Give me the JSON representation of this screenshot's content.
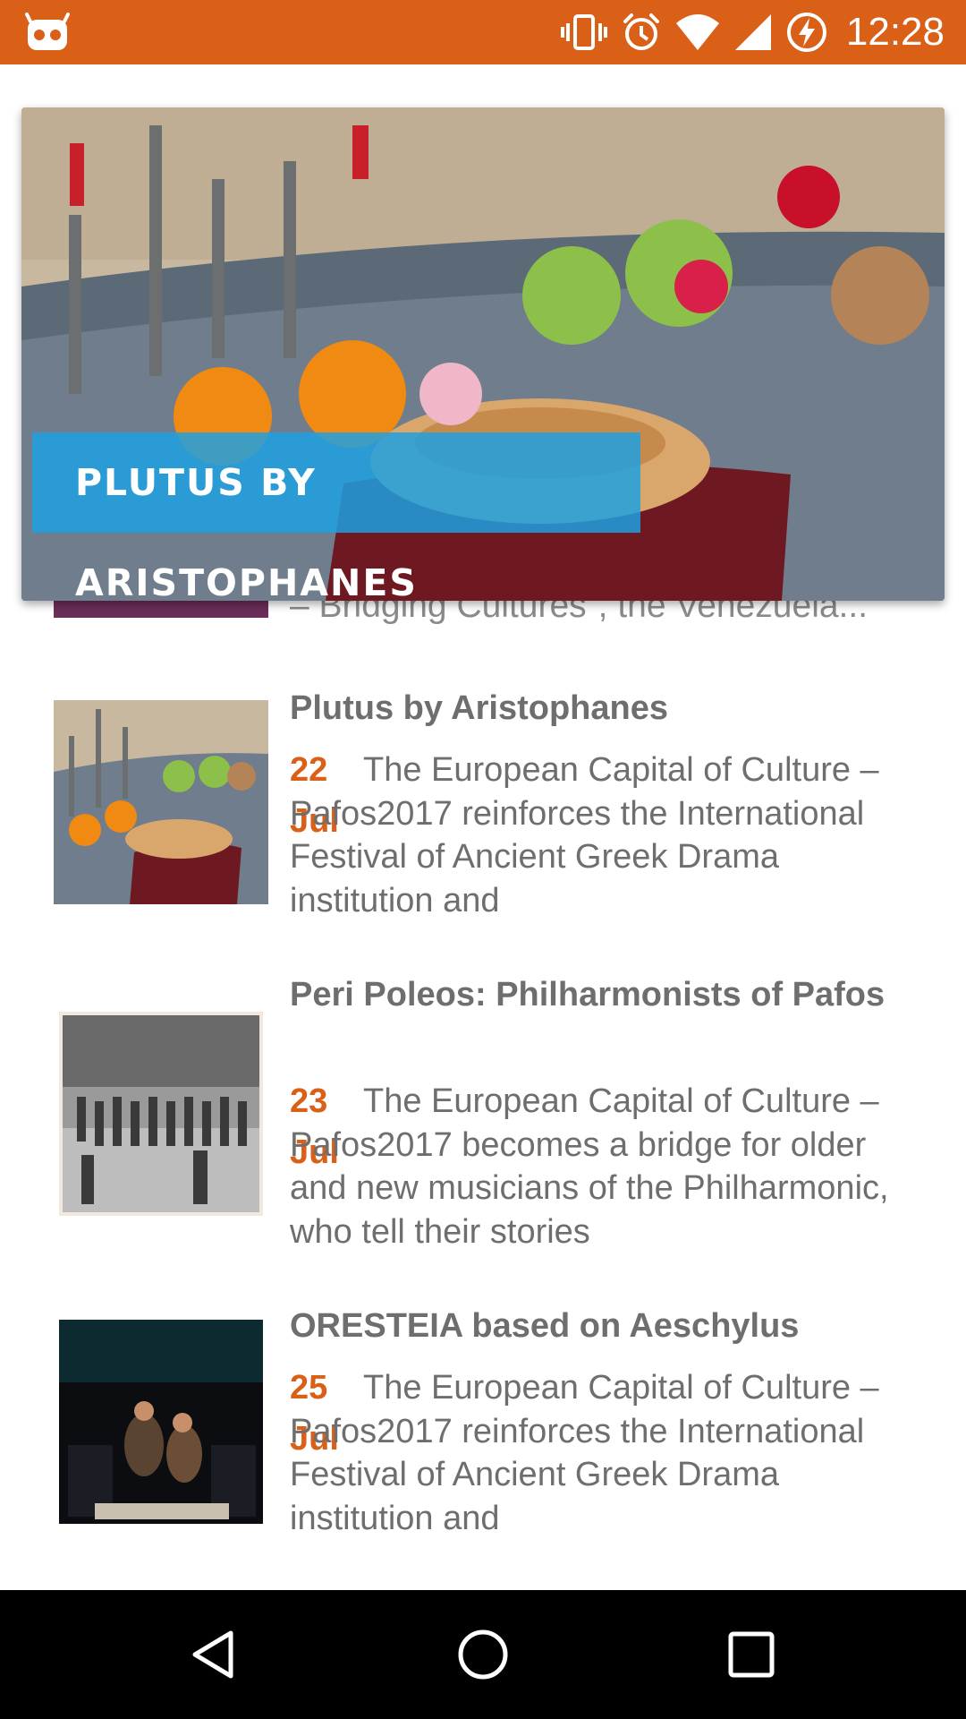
{
  "status_bar": {
    "time": "12:28",
    "icons": [
      "android-debug-icon",
      "vibrate-icon",
      "alarm-icon",
      "wifi-icon",
      "signal-icon",
      "battery-charging-icon"
    ],
    "color": "#DA5F17"
  },
  "featured": {
    "title": "Plutus by Aristophanes",
    "banner_color": "#1EA0E1"
  },
  "peek_item": {
    "text": "– Bridging Cultures”, the Venezuela..."
  },
  "events": [
    {
      "title": "Plutus by Aristophanes",
      "day": "22",
      "month": "Jul",
      "description": "The European Capital of Culture – Pafos2017 reinforces the International Festival of Ancient Greek Drama institution and"
    },
    {
      "title": "Peri Poleos: Philharmonists of Pafos",
      "day": "23",
      "month": "Jul",
      "description": "The European Capital of Culture – Pafos2017 becomes a bridge for older and new musicians of the Philharmonic, who tell their stories"
    },
    {
      "title": "ORESTEIA based on Aeschylus",
      "day": "25",
      "month": "Jul",
      "description": "The European Capital of Culture – Pafos2017 reinforces the International Festival of Ancient Greek Drama institution and"
    }
  ],
  "nav_bar": {
    "buttons": [
      "back-icon",
      "home-icon",
      "recents-icon"
    ]
  }
}
